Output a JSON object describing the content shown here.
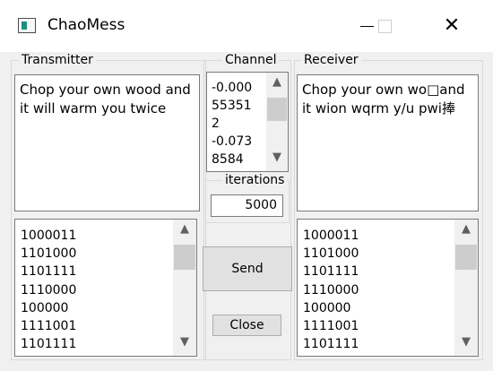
{
  "window": {
    "title": "ChaoMess",
    "minimize": "—",
    "maximize": "☐",
    "close": "✕"
  },
  "transmitter": {
    "label": "Transmitter",
    "message": "Chop your own wood and it will warm you twice",
    "binary": [
      "1000011",
      "1101000",
      "1101111",
      "1110000",
      "100000",
      "1111001",
      "1101111"
    ]
  },
  "channel": {
    "label": "Channel",
    "values": [
      "-0.000",
      "55351",
      "2",
      "-0.073",
      "8584"
    ]
  },
  "iterations": {
    "label": "iterations",
    "value": "5000"
  },
  "buttons": {
    "send": "Send",
    "close": "Close"
  },
  "receiver": {
    "label": "Receiver",
    "message": "Chop your own wo□and it wion wqrm y/u pwi捧",
    "binary": [
      "1000011",
      "1101000",
      "1101111",
      "1110000",
      "100000",
      "1111001",
      "1101111"
    ]
  },
  "icons": {
    "scroll_up": "▲",
    "scroll_down": "▼"
  }
}
